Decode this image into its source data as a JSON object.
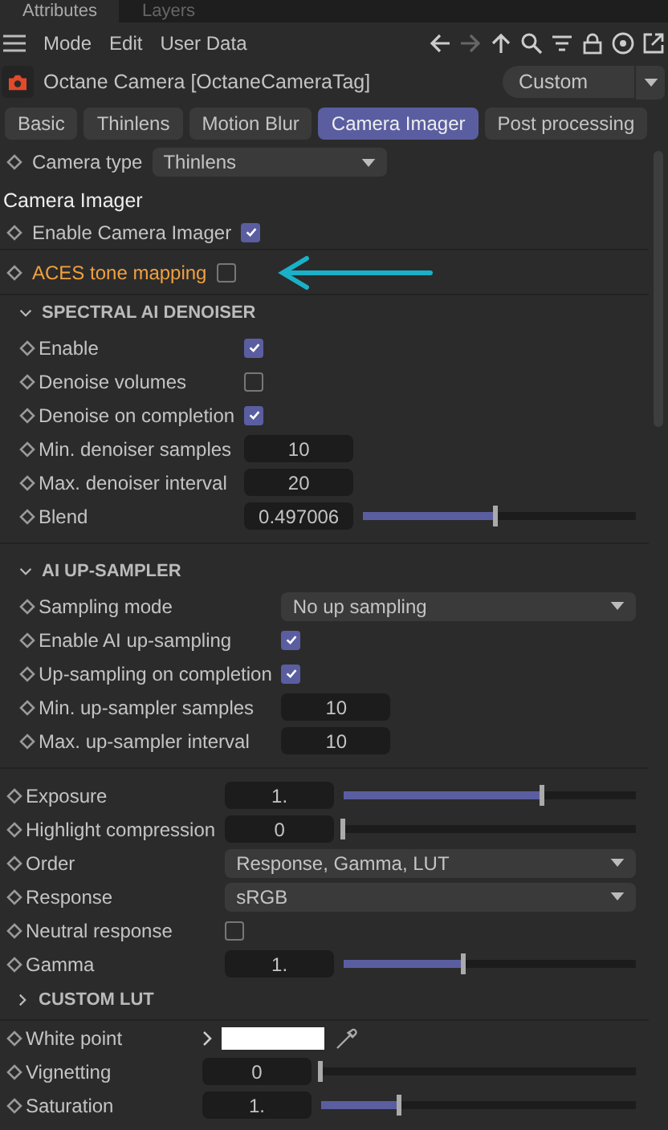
{
  "panel_tabs": [
    {
      "label": "Attributes",
      "selected": true
    },
    {
      "label": "Layers",
      "selected": false
    }
  ],
  "menu": [
    "Mode",
    "Edit",
    "User Data"
  ],
  "object": {
    "title": "Octane Camera [OctaneCameraTag]",
    "preset": "Custom"
  },
  "tabs": [
    {
      "label": "Basic",
      "selected": false
    },
    {
      "label": "Thinlens",
      "selected": false
    },
    {
      "label": "Motion Blur",
      "selected": false
    },
    {
      "label": "Camera Imager",
      "selected": true
    },
    {
      "label": "Post processing",
      "selected": false
    }
  ],
  "camera_type": {
    "label": "Camera type",
    "value": "Thinlens"
  },
  "heading": "Camera Imager",
  "top_rows": [
    {
      "label": "Enable Camera Imager",
      "checked": true,
      "highlighted": false
    },
    {
      "label": "ACES tone mapping",
      "checked": false,
      "highlighted": true
    }
  ],
  "sections": [
    {
      "title": "SPECTRAL AI DENOISER",
      "expanded": true,
      "rows": [
        {
          "kind": "checkbox",
          "label": "Enable",
          "checked": true
        },
        {
          "kind": "checkbox",
          "label": "Denoise volumes",
          "checked": false
        },
        {
          "kind": "checkbox",
          "label": "Denoise on completion",
          "checked": true
        },
        {
          "kind": "number",
          "label": "Min. denoiser samples",
          "value": "10"
        },
        {
          "kind": "number",
          "label": "Max. denoiser interval",
          "value": "20"
        },
        {
          "kind": "slider",
          "label": "Blend",
          "value": "0.497006",
          "level": 0.49
        }
      ]
    },
    {
      "title": "AI UP-SAMPLER",
      "expanded": true,
      "rows": [
        {
          "kind": "dropdown",
          "label": "Sampling mode",
          "value": "No up sampling"
        },
        {
          "kind": "checkbox",
          "label": "Enable AI up-sampling",
          "checked": true
        },
        {
          "kind": "checkbox",
          "label": "Up-sampling on completion",
          "checked": true
        },
        {
          "kind": "number",
          "label": "Min. up-sampler samples",
          "value": "10"
        },
        {
          "kind": "number",
          "label": "Max. up-sampler interval",
          "value": "10"
        }
      ]
    }
  ],
  "main_rows": [
    {
      "kind": "slider",
      "label": "Exposure",
      "value": "1.",
      "level": 0.68
    },
    {
      "kind": "slider",
      "label": "Highlight compression",
      "value": "0",
      "level": 0
    },
    {
      "kind": "dropdown",
      "label": "Order",
      "value": "Response, Gamma, LUT"
    },
    {
      "kind": "dropdown",
      "label": "Response",
      "value": "sRGB"
    },
    {
      "kind": "checkbox",
      "label": "Neutral response",
      "checked": false
    },
    {
      "kind": "slider",
      "label": "Gamma",
      "value": "1.",
      "level": 0.41
    }
  ],
  "custom_lut": {
    "title": "CUSTOM LUT",
    "expanded": false
  },
  "bottom_rows": [
    {
      "kind": "color",
      "label": "White point"
    },
    {
      "kind": "slider",
      "label": "Vignetting",
      "value": "0",
      "level": 0
    },
    {
      "kind": "slider",
      "label": "Saturation",
      "value": "1.",
      "level": 0.25
    }
  ]
}
